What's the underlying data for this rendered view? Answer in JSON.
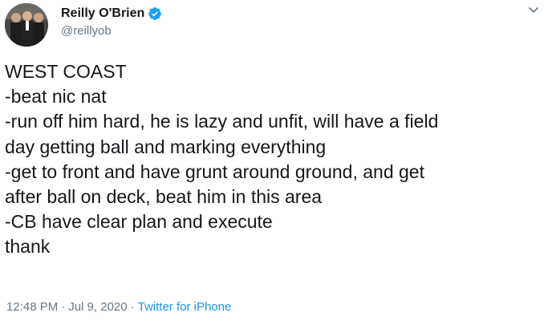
{
  "author": {
    "display_name": "Reilly O'Brien",
    "handle": "@reillyob",
    "verified": true,
    "avatar_icon": "avatar-photo"
  },
  "tweet": {
    "lines": [
      "WEST COAST",
      "-beat nic nat",
      "-run off him hard, he is lazy and unfit, will have a field",
      "day getting ball and marking everything",
      "-get to front and have grunt around ground, and get",
      "after ball on deck, beat him in this area",
      "-CB have clear plan and execute",
      "thank"
    ]
  },
  "meta": {
    "time": "12:48 PM",
    "separator": "·",
    "date": "Jul 9, 2020",
    "source": "Twitter for iPhone"
  },
  "colors": {
    "text": "#14171a",
    "muted": "#657786",
    "link": "#1b95e0",
    "verified_badge": "#1da1f2"
  },
  "icons": {
    "verified": "verified-badge-icon",
    "menu": "chevron-down-icon"
  }
}
